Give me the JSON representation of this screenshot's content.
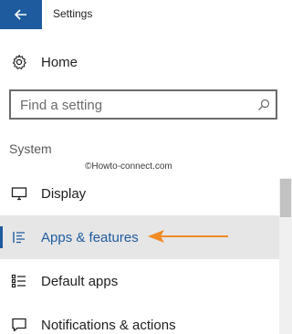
{
  "window": {
    "title": "Settings"
  },
  "home": {
    "label": "Home",
    "icon": "gear-icon"
  },
  "search": {
    "placeholder": "Find a setting",
    "value": "",
    "icon": "search-icon"
  },
  "section": {
    "title": "System"
  },
  "watermark": "©Howto-connect.com",
  "nav": {
    "items": [
      {
        "label": "Display",
        "icon": "monitor-icon",
        "selected": false
      },
      {
        "label": "Apps & features",
        "icon": "list-icon",
        "selected": true
      },
      {
        "label": "Default apps",
        "icon": "default-apps-icon",
        "selected": false
      },
      {
        "label": "Notifications & actions",
        "icon": "notifications-icon",
        "selected": false
      }
    ]
  },
  "colors": {
    "accent": "#1e5b9e",
    "selected_bg": "#e6e6e6",
    "annotation_arrow": "#f08a24"
  }
}
